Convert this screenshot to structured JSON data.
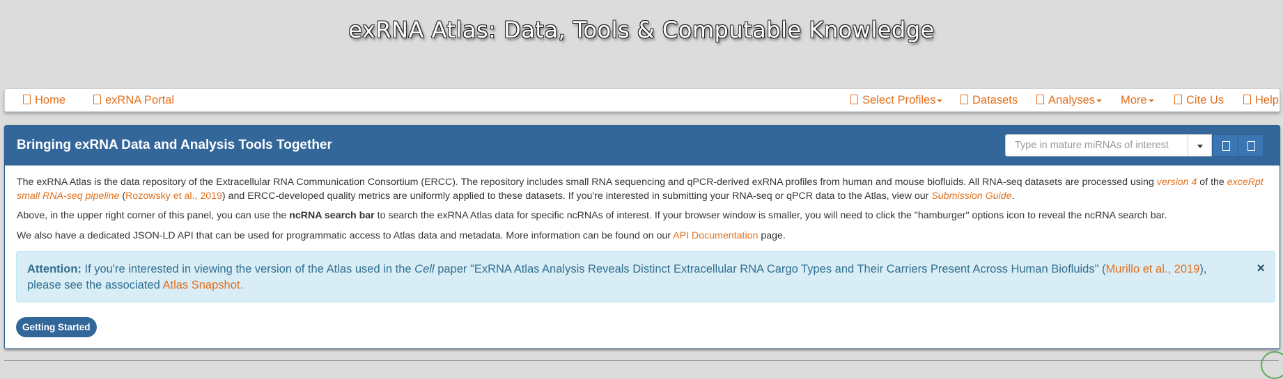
{
  "site_title": "exRNA Atlas: Data, Tools & Computable Knowledge",
  "navbar": {
    "left": [
      {
        "label": "Home",
        "icon": "home-icon"
      },
      {
        "label": "exRNA Portal",
        "icon": "portal-icon"
      }
    ],
    "right": [
      {
        "label": "Select Profiles",
        "icon": "profiles-icon",
        "dropdown": true
      },
      {
        "label": "Datasets",
        "icon": "datasets-icon",
        "dropdown": false
      },
      {
        "label": "Analyses",
        "icon": "analyses-icon",
        "dropdown": true
      },
      {
        "label": "More",
        "dropdown": true
      },
      {
        "label": "Cite Us",
        "icon": "cite-icon",
        "dropdown": false
      },
      {
        "label": "Help",
        "icon": "help-icon",
        "dropdown": false
      }
    ]
  },
  "panel": {
    "title": "Bringing exRNA Data and Analysis Tools Together",
    "search_placeholder": "Type in mature miRNAs of interest",
    "para1": {
      "t1": "The exRNA Atlas is the data repository of the Extracellular RNA Communication Consortium (ERCC). The repository includes small RNA sequencing and qPCR-derived exRNA profiles from human and mouse biofluids. All RNA-seq datasets are processed using ",
      "link1": "version 4",
      "t2": " of the ",
      "link2": "exceRpt small RNA-seq pipeline",
      "t3": " (",
      "link3": "Rozowsky et al., 2019",
      "t4": ") and ERCC-developed quality metrics are uniformly applied to these datasets. If you're interested in submitting your RNA-seq or qPCR data to the Atlas, view our ",
      "link4": "Submission Guide",
      "t5": "."
    },
    "para2": {
      "t1": "Above, in the upper right corner of this panel, you can use the ",
      "bold": "ncRNA search bar",
      "t2": " to search the exRNA Atlas data for specific ncRNAs of interest. If your browser window is smaller, you will need to click the \"hamburger\" options icon to reveal the ncRNA search bar."
    },
    "para3": {
      "t1": "We also have a dedicated JSON-LD API that can be used for programmatic access to Atlas data and metadata. More information can be found on our ",
      "link": "API Documentation",
      "t2": " page."
    },
    "alert": {
      "strong": "Attention:",
      "t1": " If you're interested in viewing the version of the Atlas used in the ",
      "em": "Cell",
      "t2": " paper \"ExRNA Atlas Analysis Reveals Distinct Extracellular RNA Cargo Types and Their Carriers Present Across Human Biofluids\" (",
      "link1": "Murillo et al., 2019",
      "t3": "), please see the associated ",
      "link2": "Atlas Snapshot.",
      "close": "×"
    },
    "getting_started": "Getting Started"
  },
  "colors": {
    "accent_link": "#e0701c",
    "panel_header": "#336699",
    "alert_bg": "#d9edf7",
    "alert_text": "#31708f",
    "page_bg": "#dcdcdc"
  }
}
